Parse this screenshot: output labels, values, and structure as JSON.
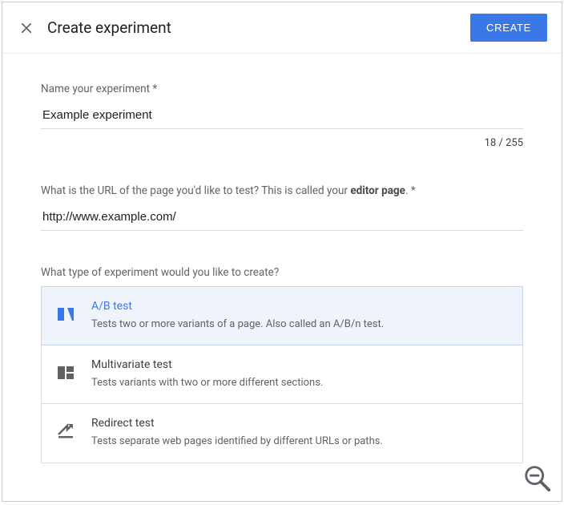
{
  "header": {
    "title": "Create experiment",
    "create_button": "CREATE"
  },
  "name_field": {
    "label": "Name your experiment *",
    "value": "Example experiment",
    "char_count": "18 / 255"
  },
  "url_field": {
    "label_prefix": "What is the URL of the page you'd like to test? This is called your ",
    "label_bold": "editor page",
    "label_suffix": ". *",
    "value": "http://www.example.com/"
  },
  "type_section": {
    "label": "What type of experiment would you like to create?",
    "options": [
      {
        "title": "A/B test",
        "desc": "Tests two or more variants of a page. Also called an A/B/n test."
      },
      {
        "title": "Multivariate test",
        "desc": "Tests variants with two or more different sections."
      },
      {
        "title": "Redirect test",
        "desc": "Tests separate web pages identified by different URLs or paths."
      }
    ]
  }
}
